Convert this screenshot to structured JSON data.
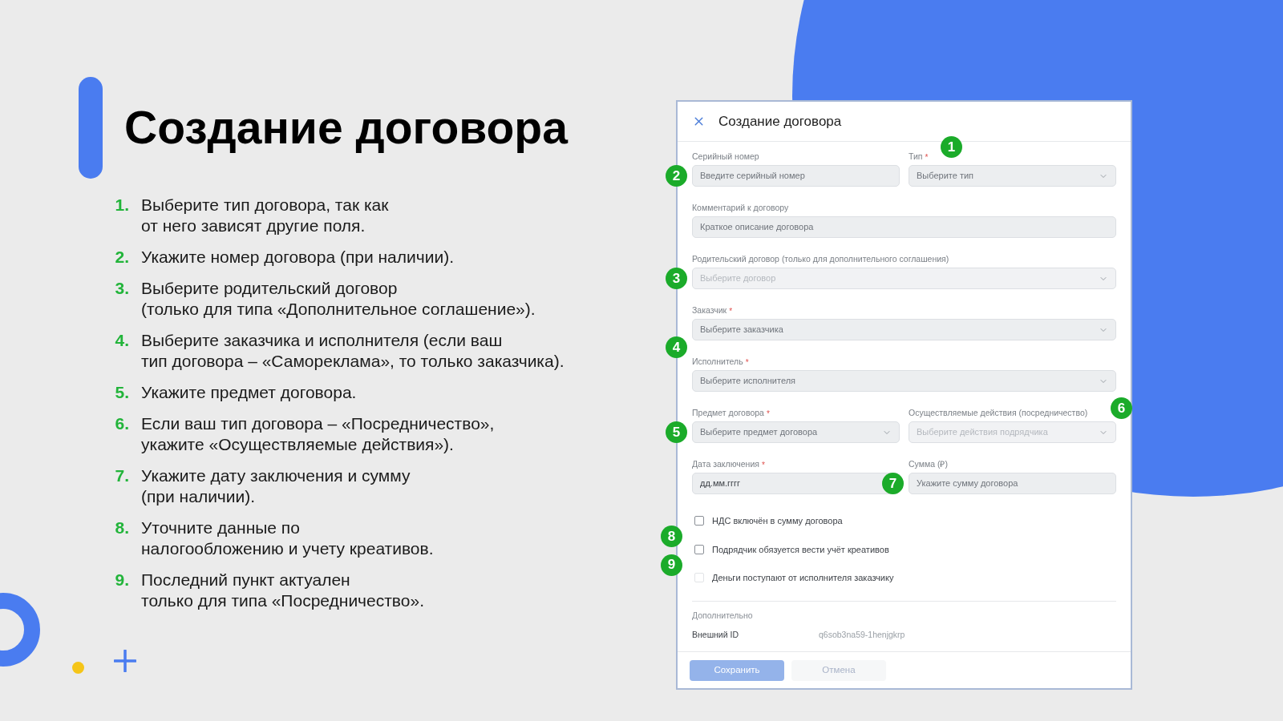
{
  "slide": {
    "title": "Создание договора",
    "steps": [
      {
        "number": "1.",
        "lines": [
          "Выберите тип договора, так как",
          "от него зависят другие поля."
        ]
      },
      {
        "number": "2.",
        "lines": [
          "Укажите номер договора (при наличии)."
        ]
      },
      {
        "number": "3.",
        "lines": [
          "Выберите родительский договор",
          "(только для типа «Дополнительное соглашение»)."
        ]
      },
      {
        "number": "4.",
        "lines": [
          "Выберите заказчика и исполнителя (если ваш",
          "тип договора – «Самореклама», то только заказчика)."
        ]
      },
      {
        "number": "5.",
        "lines": [
          "Укажите предмет договора."
        ]
      },
      {
        "number": "6.",
        "lines": [
          "Если ваш тип договора – «Посредничество»,",
          "укажите «Осуществляемые действия»)."
        ]
      },
      {
        "number": "7.",
        "lines": [
          "Укажите дату заключения и сумму",
          "(при наличии)."
        ]
      },
      {
        "number": "8.",
        "lines": [
          "Уточните данные по",
          "налогообложению и учету креативов."
        ]
      },
      {
        "number": "9.",
        "lines": [
          "Последний пункт актуален",
          "только для типа «Посредничество»."
        ]
      }
    ]
  },
  "form": {
    "title": "Создание договора",
    "rows": [
      {
        "fields": [
          {
            "kind": "text",
            "label": "Серийный номер",
            "placeholder": "Введите серийный номер",
            "disabled": false,
            "badge": {
              "number": "2",
              "kind": "left"
            }
          },
          {
            "kind": "select",
            "label": "Тип",
            "mark": "*",
            "placeholder": "Выберите тип",
            "disabled": false,
            "badge": {
              "number": "1",
              "kind": "label"
            }
          }
        ]
      },
      {
        "fields": [
          {
            "kind": "text",
            "label": "Комментарий к договору",
            "placeholder": "Краткое описание договора",
            "disabled": false
          }
        ]
      },
      {
        "fields": [
          {
            "kind": "select",
            "label": "Родительский договор (только для дополнительного соглашения)",
            "placeholder": "Выберите договор",
            "disabled": true,
            "badge": {
              "number": "3",
              "kind": "left"
            }
          }
        ]
      },
      {
        "fields": [
          {
            "kind": "select",
            "label": "Заказчик",
            "mark": "*",
            "placeholder": "Выберите заказчика",
            "disabled": false
          }
        ]
      },
      {
        "fields": [
          {
            "kind": "select",
            "label": "Исполнитель",
            "mark": "*",
            "placeholder": "Выберите исполнителя",
            "disabled": false,
            "badge": {
              "number": "4",
              "kind": "above"
            }
          }
        ]
      },
      {
        "fields": [
          {
            "kind": "select",
            "label": "Предмет договора",
            "mark": "*",
            "placeholder": "Выберите предмет договора",
            "disabled": false,
            "badge": {
              "number": "5",
              "kind": "left"
            }
          },
          {
            "kind": "select",
            "label": "Осуществляемые действия (посредничество)",
            "placeholder": "Выберите действия подрядчика",
            "disabled": true,
            "badge": {
              "number": "6",
              "kind": "right"
            }
          }
        ]
      },
      {
        "fields": [
          {
            "kind": "date",
            "label": "Дата заключения",
            "mark": "*",
            "placeholder": "дд.мм.гггг",
            "disabled": false
          },
          {
            "kind": "text",
            "label": "Сумма (₽)",
            "placeholder": "Укажите сумму договора",
            "disabled": false,
            "badge": {
              "number": "7",
              "kind": "left"
            }
          }
        ]
      }
    ],
    "checkboxes": [
      {
        "label": "НДС включён в сумму договора",
        "checked": false,
        "disabled": false,
        "badge": {
          "number": "8",
          "kind": "below"
        }
      },
      {
        "label": "Подрядчик обязуется вести учёт креативов",
        "checked": false,
        "disabled": false,
        "badge": {
          "number": "9",
          "kind": "below"
        }
      },
      {
        "label": "Деньги поступают от исполнителя заказчику",
        "checked": false,
        "disabled": true
      }
    ],
    "extra": {
      "heading": "Дополнительно",
      "rows": [
        {
          "label": "Внешний ID",
          "value": "q6sob3na59-1henjgkrp"
        }
      ]
    },
    "buttons": [
      {
        "kind": "primary",
        "label": "Сохранить",
        "disabled": true
      },
      {
        "kind": "secondary",
        "label": "Отмена",
        "disabled": true
      }
    ]
  }
}
